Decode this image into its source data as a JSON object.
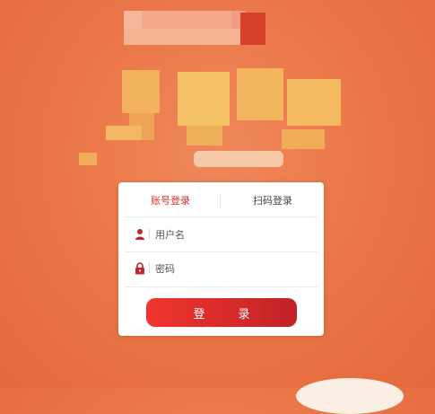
{
  "tabs": {
    "account_login": "账号登录",
    "scan_login": "扫码登录"
  },
  "form": {
    "username_placeholder": "用户名",
    "password_placeholder": "密码",
    "username_value": "",
    "password_value": ""
  },
  "login_button": "登　录",
  "colors": {
    "background": "#ea7546",
    "accent": "#d9302b",
    "button_start": "#f0352d",
    "button_end": "#bf2227"
  },
  "icons": {
    "username": "user-icon",
    "password": "lock-icon"
  }
}
